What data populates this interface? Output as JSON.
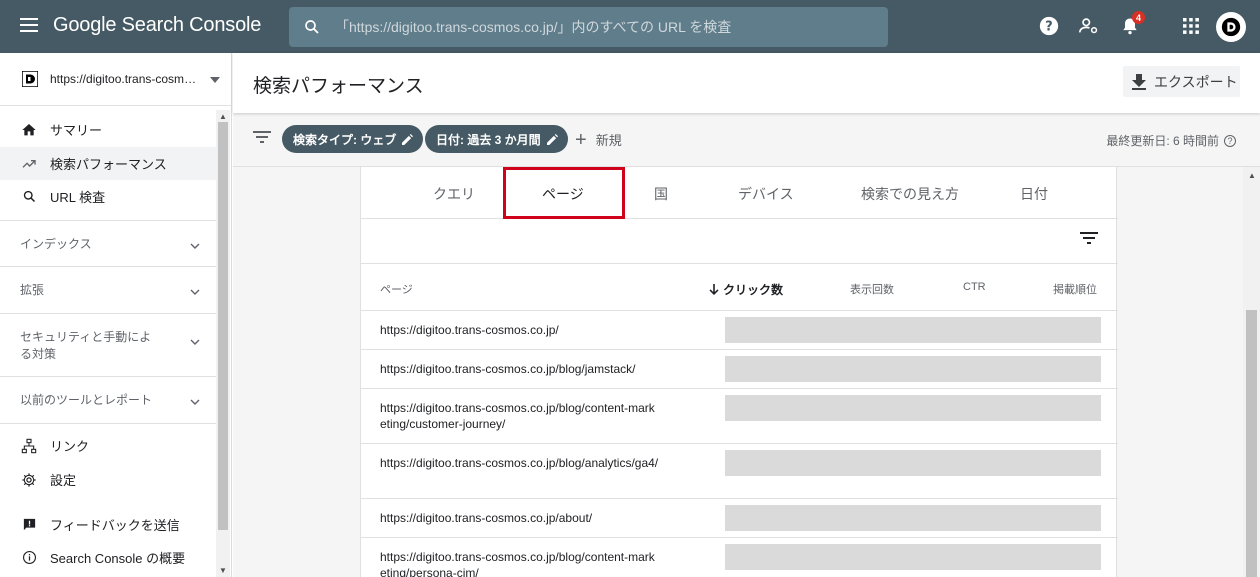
{
  "app": {
    "title": "Google Search Console",
    "search_placeholder": "「https://digitoo.trans-cosmos.co.jp/」内のすべての URL を検査",
    "notification_count": "4"
  },
  "sidebar": {
    "property": "https://digitoo.trans-cosmos.co.jp/",
    "nav": [
      {
        "label": "サマリー",
        "icon": "home-icon"
      },
      {
        "label": "検索パフォーマンス",
        "icon": "trending-up-icon"
      },
      {
        "label": "URL 検査",
        "icon": "search-icon"
      }
    ],
    "sections": [
      {
        "label": "インデックス"
      },
      {
        "label": "拡張"
      },
      {
        "label": "セキュリティと手動による対策"
      },
      {
        "label": "以前のツールとレポート"
      }
    ],
    "bottom": [
      {
        "label": "リンク",
        "icon": "links-icon"
      },
      {
        "label": "設定",
        "icon": "gear-icon"
      },
      {
        "label": "フィードバックを送信",
        "icon": "feedback-icon"
      },
      {
        "label": "Search Console の概要",
        "icon": "info-icon"
      }
    ]
  },
  "header": {
    "title": "検索パフォーマンス",
    "export_label": "エクスポート"
  },
  "filters": {
    "chips": [
      "検索タイプ: ウェブ",
      "日付: 過去 3 か月間"
    ],
    "new_label": "新規",
    "updated": "最終更新日: 6 時間前"
  },
  "tabs": [
    "クエリ",
    "ページ",
    "国",
    "デバイス",
    "検索での見え方",
    "日付"
  ],
  "table": {
    "headers": [
      "ページ",
      "クリック数",
      "表示回数",
      "CTR",
      "掲載順位"
    ],
    "rows": [
      "https://digitoo.trans-cosmos.co.jp/",
      "https://digitoo.trans-cosmos.co.jp/blog/jamstack/",
      "https://digitoo.trans-cosmos.co.jp/blog/content-marketing/customer-journey/",
      "https://digitoo.trans-cosmos.co.jp/blog/analytics/ga4/",
      "https://digitoo.trans-cosmos.co.jp/about/",
      "https://digitoo.trans-cosmos.co.jp/blog/content-marketing/persona-cim/"
    ]
  },
  "colors": {
    "topbar": "#455a64",
    "chip": "#455a64",
    "highlight": "#d0021b"
  }
}
